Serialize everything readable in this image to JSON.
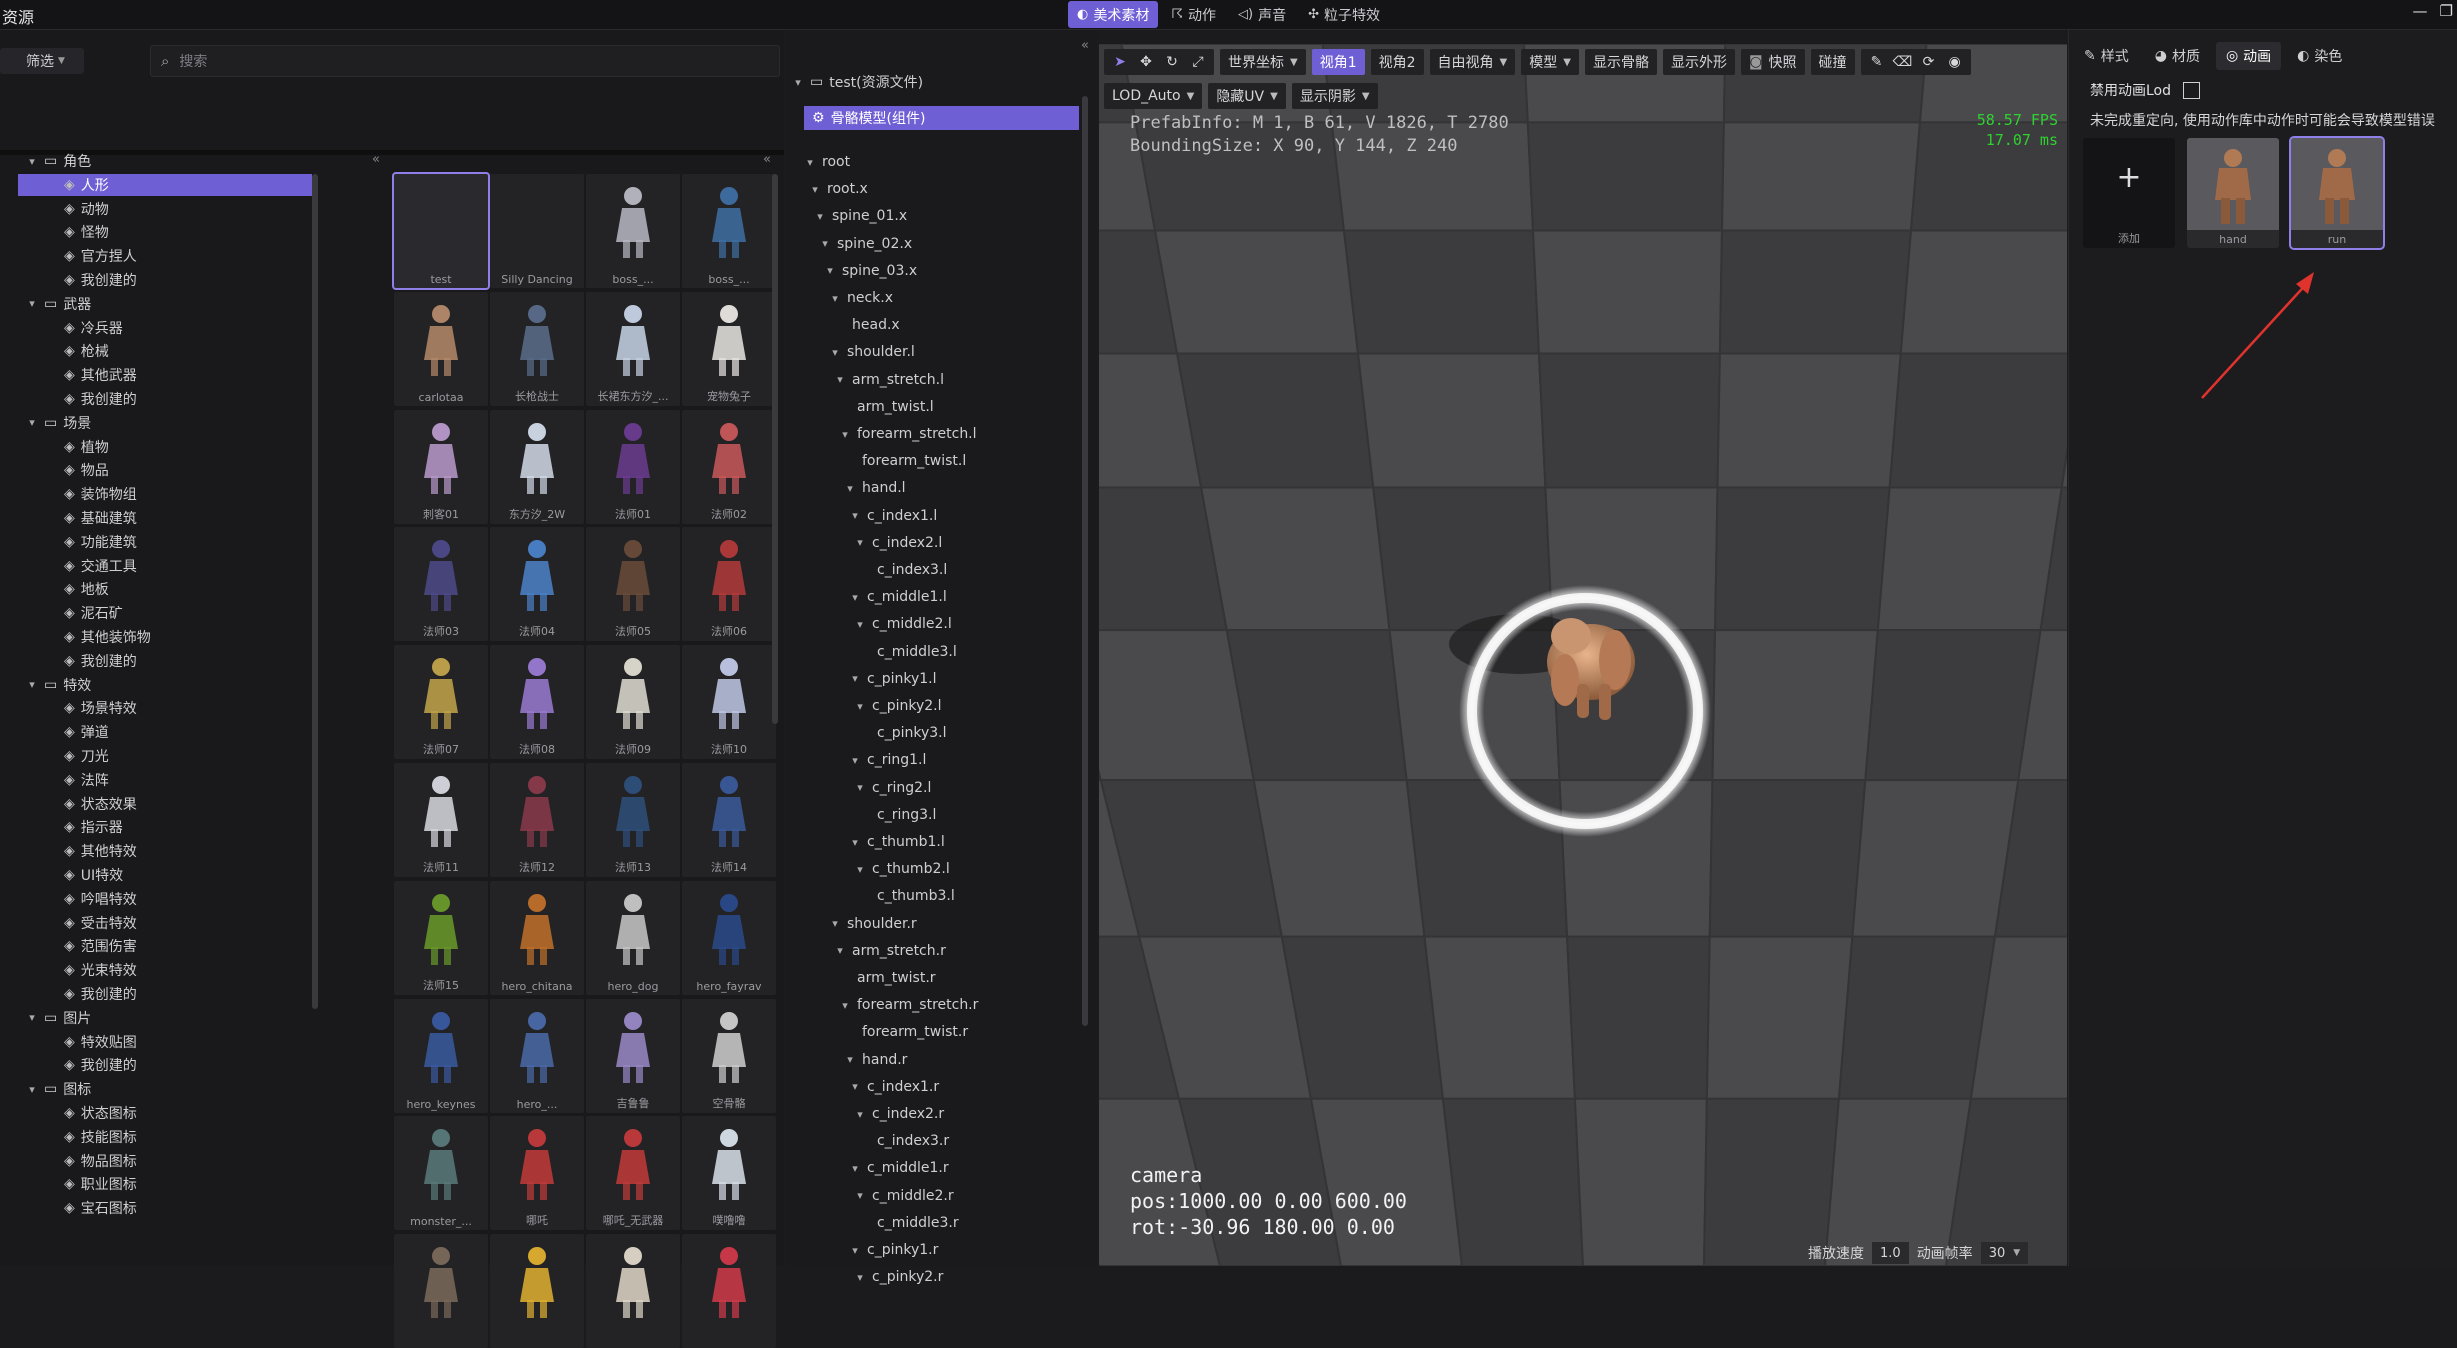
{
  "app": {
    "title": "资源"
  },
  "top_tabs": [
    {
      "label": "美术素材",
      "icon": "palette-icon",
      "active": true
    },
    {
      "label": "动作",
      "icon": "running-icon",
      "active": false
    },
    {
      "label": "声音",
      "icon": "speaker-icon",
      "active": false
    },
    {
      "label": "粒子特效",
      "icon": "particles-icon",
      "active": false
    }
  ],
  "left": {
    "filter_label": "筛选",
    "search_placeholder": "搜索",
    "tree": [
      {
        "label": "角色",
        "level": 0,
        "type": "folder"
      },
      {
        "label": "人形",
        "level": 1,
        "type": "item",
        "selected": true
      },
      {
        "label": "动物",
        "level": 1,
        "type": "item"
      },
      {
        "label": "怪物",
        "level": 1,
        "type": "item"
      },
      {
        "label": "官方捏人",
        "level": 1,
        "type": "item"
      },
      {
        "label": "我创建的",
        "level": 1,
        "type": "item"
      },
      {
        "label": "武器",
        "level": 0,
        "type": "folder"
      },
      {
        "label": "冷兵器",
        "level": 1,
        "type": "item"
      },
      {
        "label": "枪械",
        "level": 1,
        "type": "item"
      },
      {
        "label": "其他武器",
        "level": 1,
        "type": "item"
      },
      {
        "label": "我创建的",
        "level": 1,
        "type": "item"
      },
      {
        "label": "场景",
        "level": 0,
        "type": "folder"
      },
      {
        "label": "植物",
        "level": 1,
        "type": "item"
      },
      {
        "label": "物品",
        "level": 1,
        "type": "item"
      },
      {
        "label": "装饰物组",
        "level": 1,
        "type": "item"
      },
      {
        "label": "基础建筑",
        "level": 1,
        "type": "item"
      },
      {
        "label": "功能建筑",
        "level": 1,
        "type": "item"
      },
      {
        "label": "交通工具",
        "level": 1,
        "type": "item"
      },
      {
        "label": "地板",
        "level": 1,
        "type": "item"
      },
      {
        "label": "泥石矿",
        "level": 1,
        "type": "item"
      },
      {
        "label": "其他装饰物",
        "level": 1,
        "type": "item"
      },
      {
        "label": "我创建的",
        "level": 1,
        "type": "item"
      },
      {
        "label": "特效",
        "level": 0,
        "type": "folder"
      },
      {
        "label": "场景特效",
        "level": 1,
        "type": "item"
      },
      {
        "label": "弹道",
        "level": 1,
        "type": "item"
      },
      {
        "label": "刀光",
        "level": 1,
        "type": "item"
      },
      {
        "label": "法阵",
        "level": 1,
        "type": "item"
      },
      {
        "label": "状态效果",
        "level": 1,
        "type": "item"
      },
      {
        "label": "指示器",
        "level": 1,
        "type": "item"
      },
      {
        "label": "其他特效",
        "level": 1,
        "type": "item"
      },
      {
        "label": "UI特效",
        "level": 1,
        "type": "item"
      },
      {
        "label": "吟唱特效",
        "level": 1,
        "type": "item"
      },
      {
        "label": "受击特效",
        "level": 1,
        "type": "item"
      },
      {
        "label": "范围伤害",
        "level": 1,
        "type": "item"
      },
      {
        "label": "光束特效",
        "level": 1,
        "type": "item"
      },
      {
        "label": "我创建的",
        "level": 1,
        "type": "item"
      },
      {
        "label": "图片",
        "level": 0,
        "type": "folder"
      },
      {
        "label": "特效贴图",
        "level": 1,
        "type": "item"
      },
      {
        "label": "我创建的",
        "level": 1,
        "type": "item"
      },
      {
        "label": "图标",
        "level": 0,
        "type": "folder"
      },
      {
        "label": "状态图标",
        "level": 1,
        "type": "item"
      },
      {
        "label": "技能图标",
        "level": 1,
        "type": "item"
      },
      {
        "label": "物品图标",
        "level": 1,
        "type": "item"
      },
      {
        "label": "职业图标",
        "level": 1,
        "type": "item"
      },
      {
        "label": "宝石图标",
        "level": 1,
        "type": "item"
      }
    ],
    "assets": [
      {
        "label": "test",
        "color": "#2a2a2e",
        "selected": true
      },
      {
        "label": "Silly Dancing",
        "color": "#232326"
      },
      {
        "label": "boss_...",
        "color": "#b9b9c4"
      },
      {
        "label": "boss_...",
        "color": "#3f6fa3"
      },
      {
        "label": "carlotaa",
        "color": "#b58a6a"
      },
      {
        "label": "长枪战士",
        "color": "#5a6d8a"
      },
      {
        "label": "长裙东方汐_...",
        "color": "#c7d3e6"
      },
      {
        "label": "宠物兔子",
        "color": "#e9e6e3"
      },
      {
        "label": "刺客01",
        "color": "#b99acb"
      },
      {
        "label": "东方汐_2W",
        "color": "#d2dbe8"
      },
      {
        "label": "法师01",
        "color": "#6b3c91"
      },
      {
        "label": "法师02",
        "color": "#c9585a"
      },
      {
        "label": "法师03",
        "color": "#4e4a8a"
      },
      {
        "label": "法师04",
        "color": "#4b82c9"
      },
      {
        "label": "法师05",
        "color": "#6a4b3a"
      },
      {
        "label": "法师06",
        "color": "#b33a3a"
      },
      {
        "label": "法师07",
        "color": "#c2a44a"
      },
      {
        "label": "法师08",
        "color": "#9a7bd3"
      },
      {
        "label": "法师09",
        "color": "#e0ddd2"
      },
      {
        "label": "法师10",
        "color": "#c0c8e6"
      },
      {
        "label": "法师11",
        "color": "#d8d8e0"
      },
      {
        "label": "法师12",
        "color": "#8a3a4a"
      },
      {
        "label": "法师13",
        "color": "#2e4f7a"
      },
      {
        "label": "法师14",
        "color": "#3a5a9a"
      },
      {
        "label": "法师15",
        "color": "#6a9a2a"
      },
      {
        "label": "hero_chitana",
        "color": "#c0702a"
      },
      {
        "label": "hero_dog",
        "color": "#c8c8c8"
      },
      {
        "label": "hero_fayrav",
        "color": "#2a4a8a"
      },
      {
        "label": "hero_keynes",
        "color": "#3a5aa0"
      },
      {
        "label": "hero_...",
        "color": "#4a6aa8"
      },
      {
        "label": "吉鲁鲁",
        "color": "#9a8ac8"
      },
      {
        "label": "空骨骼",
        "color": "#cfcfcf"
      },
      {
        "label": "monster_...",
        "color": "#5a7a7a"
      },
      {
        "label": "哪吒",
        "color": "#c23a3a"
      },
      {
        "label": "哪吒_无武器",
        "color": "#c23a3a"
      },
      {
        "label": "噗噜噜",
        "color": "#d8e0ea"
      },
      {
        "label": "",
        "color": "#7a6a5a"
      },
      {
        "label": "",
        "color": "#e0b030"
      },
      {
        "label": "",
        "color": "#e0d8c8"
      },
      {
        "label": "",
        "color": "#d03a4a"
      }
    ]
  },
  "middle": {
    "root_label": "test(资源文件)",
    "component_label": "骨骼模型(组件)",
    "bones": [
      {
        "label": "root",
        "indent": 0,
        "arrow": true
      },
      {
        "label": "root.x",
        "indent": 1,
        "arrow": true
      },
      {
        "label": "spine_01.x",
        "indent": 2,
        "arrow": true
      },
      {
        "label": "spine_02.x",
        "indent": 3,
        "arrow": true
      },
      {
        "label": "spine_03.x",
        "indent": 4,
        "arrow": true
      },
      {
        "label": "neck.x",
        "indent": 5,
        "arrow": true
      },
      {
        "label": "head.x",
        "indent": 6,
        "arrow": false
      },
      {
        "label": "shoulder.l",
        "indent": 5,
        "arrow": true
      },
      {
        "label": "arm_stretch.l",
        "indent": 6,
        "arrow": true
      },
      {
        "label": "arm_twist.l",
        "indent": 7,
        "arrow": false
      },
      {
        "label": "forearm_stretch.l",
        "indent": 7,
        "arrow": true
      },
      {
        "label": "forearm_twist.l",
        "indent": 8,
        "arrow": false
      },
      {
        "label": "hand.l",
        "indent": 8,
        "arrow": true
      },
      {
        "label": "c_index1.l",
        "indent": 9,
        "arrow": true
      },
      {
        "label": "c_index2.l",
        "indent": 10,
        "arrow": true
      },
      {
        "label": "c_index3.l",
        "indent": 11,
        "arrow": false
      },
      {
        "label": "c_middle1.l",
        "indent": 9,
        "arrow": true
      },
      {
        "label": "c_middle2.l",
        "indent": 10,
        "arrow": true
      },
      {
        "label": "c_middle3.l",
        "indent": 11,
        "arrow": false
      },
      {
        "label": "c_pinky1.l",
        "indent": 9,
        "arrow": true
      },
      {
        "label": "c_pinky2.l",
        "indent": 10,
        "arrow": true
      },
      {
        "label": "c_pinky3.l",
        "indent": 11,
        "arrow": false
      },
      {
        "label": "c_ring1.l",
        "indent": 9,
        "arrow": true
      },
      {
        "label": "c_ring2.l",
        "indent": 10,
        "arrow": true
      },
      {
        "label": "c_ring3.l",
        "indent": 11,
        "arrow": false
      },
      {
        "label": "c_thumb1.l",
        "indent": 9,
        "arrow": true
      },
      {
        "label": "c_thumb2.l",
        "indent": 10,
        "arrow": true
      },
      {
        "label": "c_thumb3.l",
        "indent": 11,
        "arrow": false
      },
      {
        "label": "shoulder.r",
        "indent": 5,
        "arrow": true
      },
      {
        "label": "arm_stretch.r",
        "indent": 6,
        "arrow": true
      },
      {
        "label": "arm_twist.r",
        "indent": 7,
        "arrow": false
      },
      {
        "label": "forearm_stretch.r",
        "indent": 7,
        "arrow": true
      },
      {
        "label": "forearm_twist.r",
        "indent": 8,
        "arrow": false
      },
      {
        "label": "hand.r",
        "indent": 8,
        "arrow": true
      },
      {
        "label": "c_index1.r",
        "indent": 9,
        "arrow": true
      },
      {
        "label": "c_index2.r",
        "indent": 10,
        "arrow": true
      },
      {
        "label": "c_index3.r",
        "indent": 11,
        "arrow": false
      },
      {
        "label": "c_middle1.r",
        "indent": 9,
        "arrow": true
      },
      {
        "label": "c_middle2.r",
        "indent": 10,
        "arrow": true
      },
      {
        "label": "c_middle3.r",
        "indent": 11,
        "arrow": false
      },
      {
        "label": "c_pinky1.r",
        "indent": 9,
        "arrow": true
      },
      {
        "label": "c_pinky2.r",
        "indent": 10,
        "arrow": true
      }
    ]
  },
  "viewport": {
    "toolbar1": [
      {
        "label": "世界坐标",
        "dropdown": true
      },
      {
        "label": "视角1",
        "active": true
      },
      {
        "label": "视角2"
      },
      {
        "label": "自由视角",
        "dropdown": true
      },
      {
        "label": "模型",
        "dropdown": true
      },
      {
        "label": "显示骨骼"
      },
      {
        "label": "显示外形"
      },
      {
        "label": "快照",
        "icon": "camera-icon"
      },
      {
        "label": "碰撞"
      }
    ],
    "toolbar2": [
      {
        "label": "LOD_Auto",
        "dropdown": true
      },
      {
        "label": "隐藏UV",
        "dropdown": true
      },
      {
        "label": "显示阴影",
        "dropdown": true
      }
    ],
    "prefab_info": "PrefabInfo: M 1, B 61, V 1826, T 2780",
    "bounding_size": "BoundingSize: X 90, Y 144, Z 240",
    "fps": "58.57 FPS",
    "ms": "17.07 ms",
    "camera_label": "camera",
    "camera_pos": "pos:1000.00 0.00 600.00",
    "camera_rot": "rot:-30.96 180.00 0.00",
    "play_speed_label": "播放速度",
    "play_speed": "1.0",
    "frame_rate_label": "动画帧率",
    "frame_rate": "30"
  },
  "right": {
    "tabs": [
      {
        "label": "样式",
        "icon": "pencil-icon"
      },
      {
        "label": "材质",
        "icon": "material-icon"
      },
      {
        "label": "动画",
        "icon": "play-circle-icon",
        "active": true
      },
      {
        "label": "染色",
        "icon": "dye-icon"
      }
    ],
    "disable_lod_label": "禁用动画Lod",
    "warning": "未完成重定向, 使用动作库中动作时可能会导致模型错误",
    "animations": [
      {
        "label": "添加",
        "add": true
      },
      {
        "label": "hand"
      },
      {
        "label": "run",
        "selected": true
      }
    ]
  },
  "colors": {
    "accent": "#6f5fd4",
    "fps": "#2fd12f",
    "arrow": "#e0332e"
  }
}
